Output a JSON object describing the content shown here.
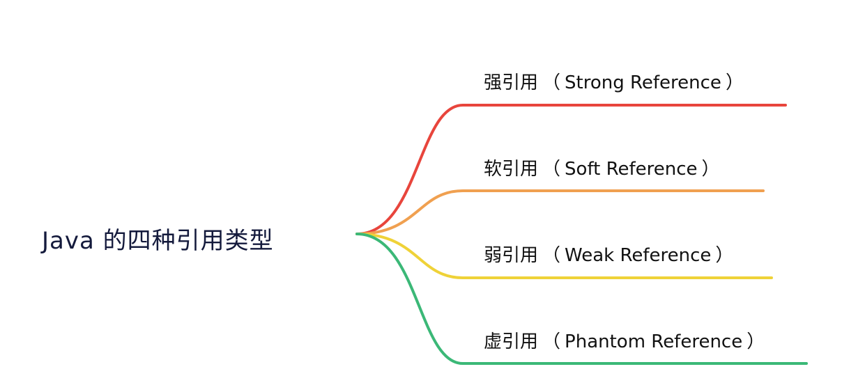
{
  "root": {
    "label": "Java 的四种引用类型"
  },
  "branches": [
    {
      "name": "强引用",
      "open": "（",
      "term": "Strong Reference",
      "close": "）",
      "color": "#e8453c"
    },
    {
      "name": "软引用",
      "open": "（",
      "term": "Soft Reference",
      "close": "）",
      "color": "#f0a050"
    },
    {
      "name": "弱引用",
      "open": "（",
      "term": "Weak Reference",
      "close": "）",
      "color": "#efd238"
    },
    {
      "name": "虚引用",
      "open": "（",
      "term": "Phantom Reference",
      "close": "）",
      "color": "#3bb877"
    }
  ]
}
